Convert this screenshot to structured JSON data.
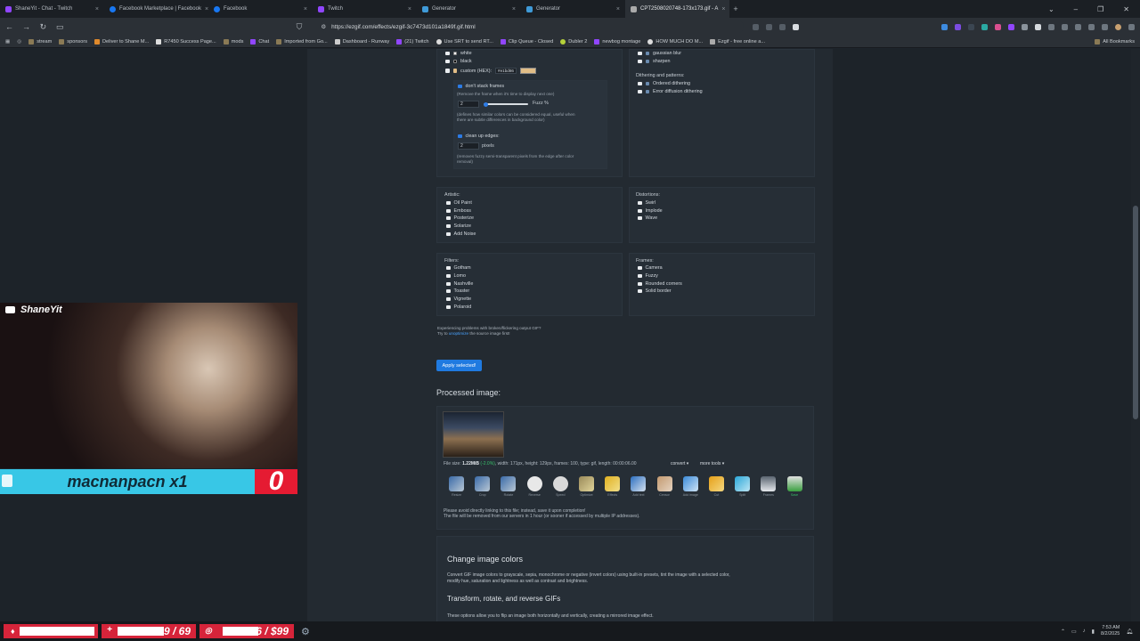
{
  "tabs": [
    {
      "label": "ShaneYit - Chat - Twitch",
      "color": "#9146ff"
    },
    {
      "label": "Facebook Marketplace | Facebook",
      "color": "#1877f2"
    },
    {
      "label": "Facebook",
      "color": "#1877f2"
    },
    {
      "label": "Twitch",
      "color": "#9146ff"
    },
    {
      "label": "Generator",
      "color": "#3f9ad8"
    },
    {
      "label": "Generator",
      "color": "#3f9ad8"
    },
    {
      "label": "CPT2508020748-173x173.gif - A",
      "color": "#aaaaaa"
    }
  ],
  "address": {
    "url": "https://ezgif.com/effects/ezgif-3c7473d101a1849f.gif.html"
  },
  "bookmarks": [
    "stream",
    "sponsors",
    "Deliver to Shane M...",
    "R7450 Success Page...",
    "mods",
    "Chat",
    "Imported from Go...",
    "Dashboard - Runway",
    "(21) Twitch",
    "Use SRT to send RT...",
    "Clip Queue - Closed",
    "Dubler 2",
    "newbog montage",
    "HOW MUCH DO M...",
    "Ezgif - free online a...",
    "All Bookmarks"
  ],
  "colors_section": {
    "white": "white",
    "black": "black",
    "custom_label": "custom (HEX):",
    "custom_value": "#e1bd86",
    "dont_stack": "don't stack frames",
    "dont_stack_desc": "(Remove the frame when it's time to display next one)",
    "fuzz_value": "2",
    "fuzz_label": "Fuzz %",
    "fuzz_desc1": "(defines how similar colors can be considered equal, useful when",
    "fuzz_desc2": "there are subtle differences in background color)",
    "cleanup": "clean up edges:",
    "cleanup_value": "2",
    "pixels": "pixels",
    "cleanup_desc1": "(removes fuzzy semi-transparent pixels from the edge after color",
    "cleanup_desc2": "removal)"
  },
  "blur_section": {
    "gaussian": "gaussian blur",
    "sharpen": "sharpen",
    "dither_title": "Dithering and patterns:",
    "ordered": "Ordered dithering",
    "error": "Error diffusion dithering"
  },
  "artistic": {
    "title": "Artistic:",
    "items": [
      "Oil Paint",
      "Emboss",
      "Posterize",
      "Solarize",
      "Add Noise"
    ]
  },
  "distortions": {
    "title": "Distortions:",
    "items": [
      "Swirl",
      "Implode",
      "Wave"
    ]
  },
  "filters": {
    "title": "Filters:",
    "items": [
      "Gotham",
      "Lomo",
      "Nashville",
      "Toaster",
      "Vignette",
      "Polaroid"
    ]
  },
  "frames": {
    "title": "Frames:",
    "items": [
      "Camera",
      "Fuzzy",
      "Rounded corners",
      "Solid border"
    ]
  },
  "problems": {
    "line1": "Experiencing problems with broken/flickering output GIF?",
    "line2a": "Try to",
    "link": "unoptimize",
    "line2b": "the source image first!"
  },
  "apply_button": "Apply selected!",
  "processed_title": "Processed image:",
  "fileinfo": {
    "prefix": "File size: ",
    "size": "1.22MiB",
    "delta": "(-2.0%)",
    "rest": ", width: 171px, height: 129px, frames: 100, type: gif, length: 00:00:06.00",
    "convert": "convert ▾",
    "more": "more tools ▾"
  },
  "tools": [
    "Resize",
    "Crop",
    "Rotate",
    "Reverse",
    "Speed",
    "Optimize",
    "Effects",
    "Add text",
    "Censor",
    "Add image",
    "Cut",
    "Split",
    "Frames",
    "Save"
  ],
  "notice1": "Please avoid directly linking to this file; instead, save it upon completion!",
  "notice2": "The file will be removed from our servers in 1 hour (or sooner if accessed by multiple IP addresses).",
  "info": {
    "h1": "Change image colors",
    "p1a": "Convert GIF image colors to grayscale, sepia, monochrome or negative (invert colors) using built-in presets, tint the image with a selected color,",
    "p1b": "modify hue, saturation and lightness as well as contrast and brightness.",
    "h2": "Transform, rotate, and reverse GIFs",
    "p2": "These options allow you to flip an image both horizontally and vertically, creating a mirrored image effect."
  },
  "overlay": {
    "channel": "ShaneYit",
    "username": "macnanpacn x1",
    "count": "0"
  },
  "taskbar": {
    "goal1": "9 / 69",
    "goal2": "$6 / $99",
    "time": "7:53 AM",
    "date": "8/2/2025"
  },
  "brand_colors": {
    "accent": "#1f7ae0",
    "overlay_blue": "#38c7e6",
    "overlay_red": "#e51b32"
  }
}
